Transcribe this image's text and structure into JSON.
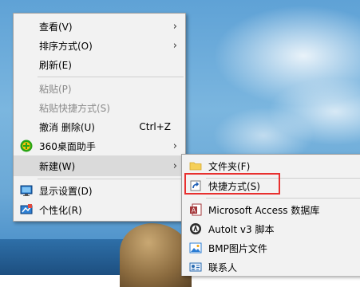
{
  "context_menu": {
    "items": [
      {
        "label": "查看(V)",
        "has_submenu": true
      },
      {
        "label": "排序方式(O)",
        "has_submenu": true
      },
      {
        "label": "刷新(E)"
      },
      {
        "label": "粘贴(P)",
        "disabled": true
      },
      {
        "label": "粘贴快捷方式(S)",
        "disabled": true
      },
      {
        "label": "撤消 删除(U)",
        "shortcut": "Ctrl+Z"
      },
      {
        "label": "360桌面助手",
        "icon": "360-icon",
        "has_submenu": true
      },
      {
        "label": "新建(W)",
        "has_submenu": true,
        "highlighted": true
      },
      {
        "label": "显示设置(D)",
        "icon": "display-icon"
      },
      {
        "label": "个性化(R)",
        "icon": "personalize-icon"
      }
    ]
  },
  "new_submenu": {
    "items": [
      {
        "label": "文件夹(F)",
        "icon": "folder-icon"
      },
      {
        "label": "快捷方式(S)",
        "icon": "shortcut-icon",
        "highlighted": true
      },
      {
        "label": "Microsoft Access 数据库",
        "icon": "access-icon"
      },
      {
        "label": "AutoIt v3 脚本",
        "icon": "autoit-icon"
      },
      {
        "label": "BMP图片文件",
        "icon": "bmp-icon"
      },
      {
        "label": "联系人",
        "icon": "contact-icon"
      }
    ]
  },
  "colors": {
    "menu_bg": "#f2f2f2",
    "hover_bg": "#dadada",
    "disabled_text": "#8a8a8a",
    "annotation_red": "#e8302f"
  }
}
